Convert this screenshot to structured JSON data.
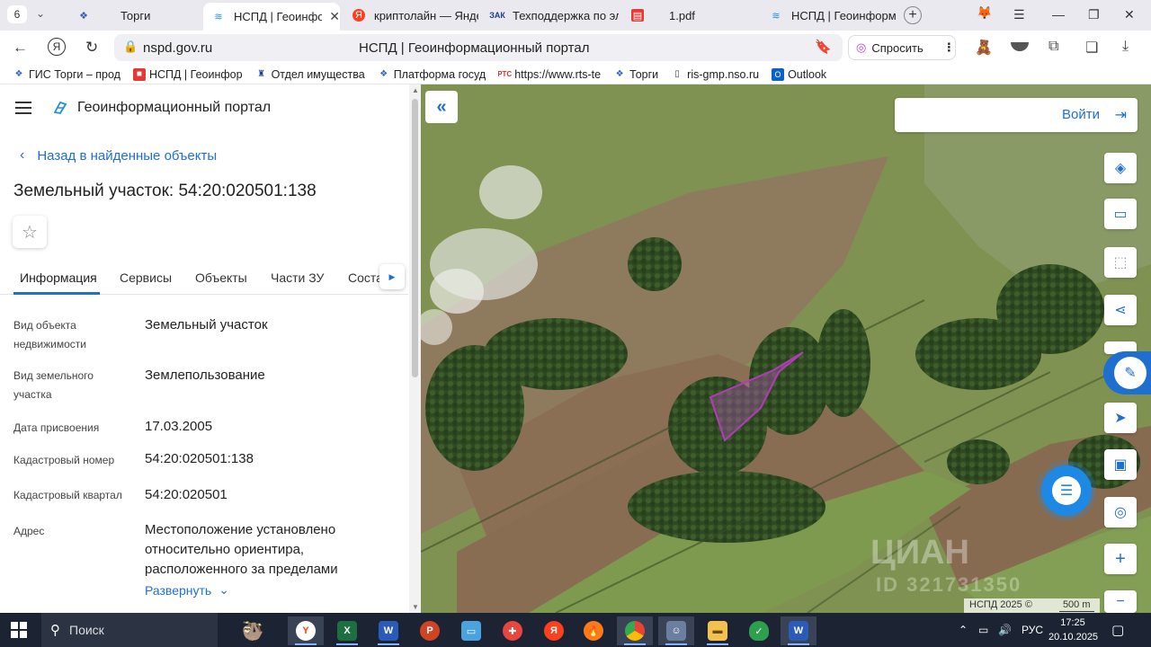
{
  "colors": {
    "accent": "#1f6fd1",
    "tabstrip": "#e9e9ef",
    "taskbar": "#1c2433",
    "parcel_outline": "#b13bb8"
  },
  "browser": {
    "tab_count": "6",
    "tabs": [
      {
        "label": "Торги",
        "icon": "gis-torgi-icon",
        "active": false
      },
      {
        "label": "НСПД | Геоинфор",
        "icon": "nspd-icon",
        "active": true
      },
      {
        "label": "криптолайн — Янде",
        "icon": "yandex-icon",
        "active": false
      },
      {
        "label": "Техподдержка по эл",
        "icon": "support-icon",
        "active": false
      },
      {
        "label": "1.pdf",
        "icon": "pdf-icon",
        "active": false
      },
      {
        "label": "НСПД | Геоинформ",
        "icon": "nspd-icon",
        "active": false
      }
    ],
    "url": "nspd.gov.ru",
    "page_title": "НСПД | Геоинформационный портал",
    "ask_label": "Спросить",
    "bookmarks": [
      {
        "label": "ГИС Торги – прод",
        "icon": "gis-torgi-icon"
      },
      {
        "label": "НСПД | Геоинфор",
        "icon": "nspd-icon"
      },
      {
        "label": "Отдел имущества",
        "icon": "emblem-icon"
      },
      {
        "label": "Платформа госуд",
        "icon": "gis-torgi-icon"
      },
      {
        "label": "https://www.rts-te",
        "icon": "rts-icon"
      },
      {
        "label": "Торги",
        "icon": "gis-torgi-icon"
      },
      {
        "label": "ris-gmp.nso.ru",
        "icon": "page-icon"
      },
      {
        "label": "Outlook",
        "icon": "outlook-icon"
      }
    ]
  },
  "panel": {
    "portal_title": "Геоинформационный портал",
    "back_label": "Назад в найденные объекты",
    "object_title": "Земельный участок: 54:20:020501:138",
    "tabs": [
      "Информация",
      "Сервисы",
      "Объекты",
      "Части ЗУ",
      "Соста"
    ],
    "rows": [
      {
        "label_lines": [
          "Вид объекта",
          "недвижимости"
        ],
        "value_lines": [
          "Земельный участок"
        ]
      },
      {
        "label_lines": [
          "Вид земельного",
          "участка"
        ],
        "value_lines": [
          "Землепользование"
        ]
      },
      {
        "label_lines": [
          "Дата присвоения"
        ],
        "value_lines": [
          "17.03.2005"
        ]
      },
      {
        "label_lines": [
          "Кадастровый номер"
        ],
        "value_lines": [
          "54:20:020501:138"
        ]
      },
      {
        "label_lines": [
          "Кадастровый квартал"
        ],
        "value_lines": [
          "54:20:020501"
        ]
      },
      {
        "label_lines": [
          "Адрес"
        ],
        "value_lines": [
          "Местоположение установлено",
          "относительно ориентира,",
          "расположенного за пределами"
        ]
      }
    ],
    "expand_label": "Развернуть"
  },
  "map": {
    "login_label": "Войти",
    "tools": [
      "layers-icon",
      "ruler-icon",
      "select-area-icon",
      "share-icon",
      "",
      "navigate-icon",
      "print-icon",
      "geolocate-icon",
      "zoom-in-icon",
      "zoom-out-icon"
    ],
    "attribution": "НСПД 2025 ©",
    "scale": "500 m",
    "watermark": "ЦИАН",
    "watermark_id": "ID 321731350"
  },
  "taskbar": {
    "search_placeholder": "Поиск",
    "apps": [
      "sloth-icon",
      "yandex-browser-icon",
      "excel-icon",
      "word-icon",
      "powerpoint-icon",
      "screen-icon",
      "app-grid-icon",
      "yandex-icon",
      "fire-icon",
      "chrome-icon",
      "person-app-icon",
      "folder-icon",
      "shield-icon",
      "word-icon"
    ],
    "language": "РУС",
    "time": "17:25",
    "date": "20.10.2025"
  }
}
